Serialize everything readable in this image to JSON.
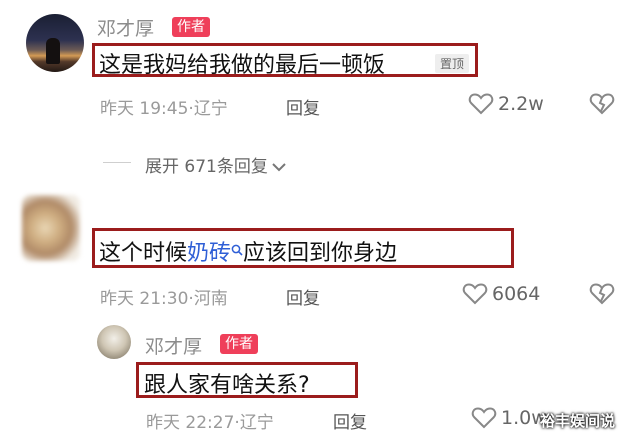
{
  "comments": [
    {
      "author": "邓才厚",
      "badge": "作者",
      "text": "这是我妈给我做的最后一顿饭",
      "pin_label": "置顶",
      "time": "昨天 19:45",
      "location": "辽宁",
      "reply_label": "回复",
      "likes": "2.2w"
    },
    {
      "text_before": "这个时候",
      "keyword": "奶砖",
      "text_after": "应该回到你身边",
      "time": "昨天 21:30",
      "location": "河南",
      "reply_label": "回复",
      "likes": "6064"
    },
    {
      "author": "邓才厚",
      "badge": "作者",
      "text": "跟人家有啥关系?",
      "time": "昨天 22:27",
      "location": "辽宁",
      "reply_label": "回复",
      "likes": "1.0w"
    }
  ],
  "expand_replies": {
    "label": "展开 671条回复"
  },
  "watermark": "裕丰娱间说",
  "colors": {
    "highlight_box": "#9b1c1c",
    "author_badge": "#ef3f5a",
    "keyword_link": "#2f5fd6"
  }
}
